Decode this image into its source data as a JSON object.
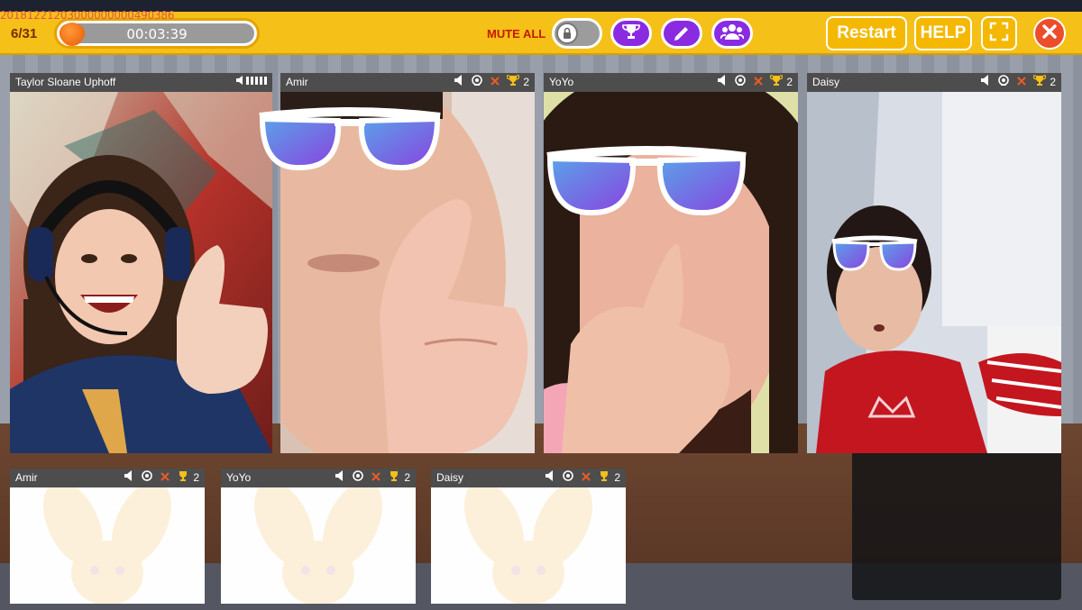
{
  "debug_id": "20181221203000000000490386",
  "topbar": {
    "page_count": "6/31",
    "time": "00:03:39",
    "mute_label": "MUTE ALL",
    "restart_label": "Restart",
    "help_label": "HELP"
  },
  "main_tiles": [
    {
      "name": "Taylor Sloane Uphoff",
      "score": ""
    },
    {
      "name": "Amir",
      "score": "2"
    },
    {
      "name": "YoYo",
      "score": "2"
    },
    {
      "name": "Daisy",
      "score": "2"
    }
  ],
  "bottom_tiles": [
    {
      "name": "Amir",
      "score": "2"
    },
    {
      "name": "YoYo",
      "score": "2"
    },
    {
      "name": "Daisy",
      "score": "2"
    }
  ],
  "colors": {
    "topbar": "#f5c018",
    "accent_purple": "#8a2be2",
    "close_red": "#ec4d2b",
    "progress_orange": "#ef6a00"
  },
  "progress_fraction": 0.06
}
